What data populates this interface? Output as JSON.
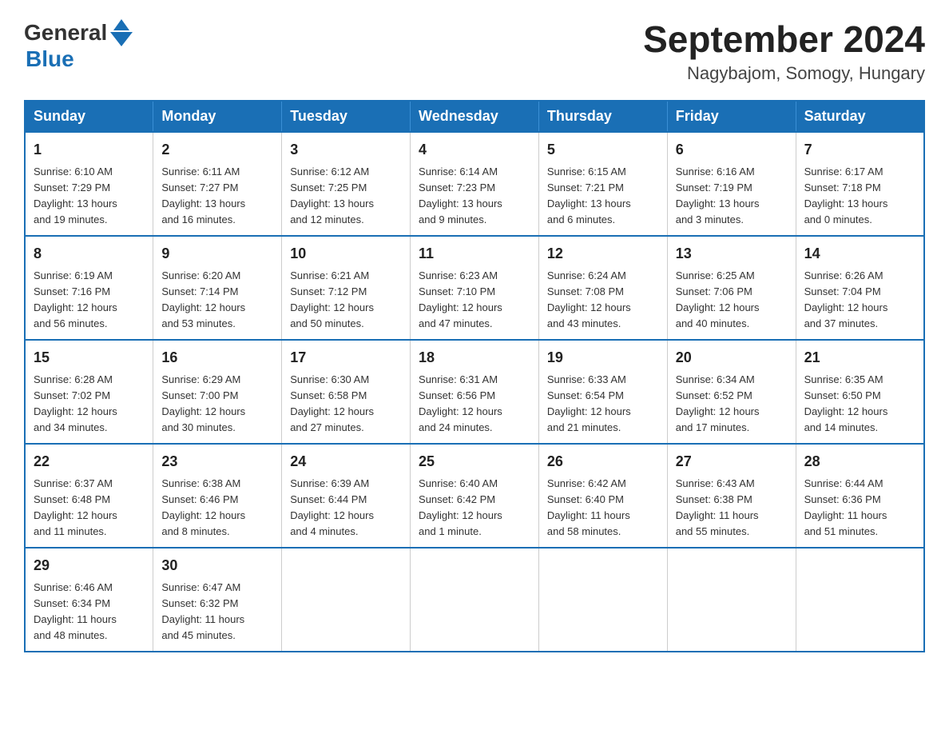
{
  "header": {
    "logo_general": "General",
    "logo_blue": "Blue",
    "title": "September 2024",
    "subtitle": "Nagybajom, Somogy, Hungary"
  },
  "days_of_week": [
    "Sunday",
    "Monday",
    "Tuesday",
    "Wednesday",
    "Thursday",
    "Friday",
    "Saturday"
  ],
  "weeks": [
    [
      {
        "day": "1",
        "sunrise": "6:10 AM",
        "sunset": "7:29 PM",
        "daylight": "13 hours and 19 minutes."
      },
      {
        "day": "2",
        "sunrise": "6:11 AM",
        "sunset": "7:27 PM",
        "daylight": "13 hours and 16 minutes."
      },
      {
        "day": "3",
        "sunrise": "6:12 AM",
        "sunset": "7:25 PM",
        "daylight": "13 hours and 12 minutes."
      },
      {
        "day": "4",
        "sunrise": "6:14 AM",
        "sunset": "7:23 PM",
        "daylight": "13 hours and 9 minutes."
      },
      {
        "day": "5",
        "sunrise": "6:15 AM",
        "sunset": "7:21 PM",
        "daylight": "13 hours and 6 minutes."
      },
      {
        "day": "6",
        "sunrise": "6:16 AM",
        "sunset": "7:19 PM",
        "daylight": "13 hours and 3 minutes."
      },
      {
        "day": "7",
        "sunrise": "6:17 AM",
        "sunset": "7:18 PM",
        "daylight": "13 hours and 0 minutes."
      }
    ],
    [
      {
        "day": "8",
        "sunrise": "6:19 AM",
        "sunset": "7:16 PM",
        "daylight": "12 hours and 56 minutes."
      },
      {
        "day": "9",
        "sunrise": "6:20 AM",
        "sunset": "7:14 PM",
        "daylight": "12 hours and 53 minutes."
      },
      {
        "day": "10",
        "sunrise": "6:21 AM",
        "sunset": "7:12 PM",
        "daylight": "12 hours and 50 minutes."
      },
      {
        "day": "11",
        "sunrise": "6:23 AM",
        "sunset": "7:10 PM",
        "daylight": "12 hours and 47 minutes."
      },
      {
        "day": "12",
        "sunrise": "6:24 AM",
        "sunset": "7:08 PM",
        "daylight": "12 hours and 43 minutes."
      },
      {
        "day": "13",
        "sunrise": "6:25 AM",
        "sunset": "7:06 PM",
        "daylight": "12 hours and 40 minutes."
      },
      {
        "day": "14",
        "sunrise": "6:26 AM",
        "sunset": "7:04 PM",
        "daylight": "12 hours and 37 minutes."
      }
    ],
    [
      {
        "day": "15",
        "sunrise": "6:28 AM",
        "sunset": "7:02 PM",
        "daylight": "12 hours and 34 minutes."
      },
      {
        "day": "16",
        "sunrise": "6:29 AM",
        "sunset": "7:00 PM",
        "daylight": "12 hours and 30 minutes."
      },
      {
        "day": "17",
        "sunrise": "6:30 AM",
        "sunset": "6:58 PM",
        "daylight": "12 hours and 27 minutes."
      },
      {
        "day": "18",
        "sunrise": "6:31 AM",
        "sunset": "6:56 PM",
        "daylight": "12 hours and 24 minutes."
      },
      {
        "day": "19",
        "sunrise": "6:33 AM",
        "sunset": "6:54 PM",
        "daylight": "12 hours and 21 minutes."
      },
      {
        "day": "20",
        "sunrise": "6:34 AM",
        "sunset": "6:52 PM",
        "daylight": "12 hours and 17 minutes."
      },
      {
        "day": "21",
        "sunrise": "6:35 AM",
        "sunset": "6:50 PM",
        "daylight": "12 hours and 14 minutes."
      }
    ],
    [
      {
        "day": "22",
        "sunrise": "6:37 AM",
        "sunset": "6:48 PM",
        "daylight": "12 hours and 11 minutes."
      },
      {
        "day": "23",
        "sunrise": "6:38 AM",
        "sunset": "6:46 PM",
        "daylight": "12 hours and 8 minutes."
      },
      {
        "day": "24",
        "sunrise": "6:39 AM",
        "sunset": "6:44 PM",
        "daylight": "12 hours and 4 minutes."
      },
      {
        "day": "25",
        "sunrise": "6:40 AM",
        "sunset": "6:42 PM",
        "daylight": "12 hours and 1 minute."
      },
      {
        "day": "26",
        "sunrise": "6:42 AM",
        "sunset": "6:40 PM",
        "daylight": "11 hours and 58 minutes."
      },
      {
        "day": "27",
        "sunrise": "6:43 AM",
        "sunset": "6:38 PM",
        "daylight": "11 hours and 55 minutes."
      },
      {
        "day": "28",
        "sunrise": "6:44 AM",
        "sunset": "6:36 PM",
        "daylight": "11 hours and 51 minutes."
      }
    ],
    [
      {
        "day": "29",
        "sunrise": "6:46 AM",
        "sunset": "6:34 PM",
        "daylight": "11 hours and 48 minutes."
      },
      {
        "day": "30",
        "sunrise": "6:47 AM",
        "sunset": "6:32 PM",
        "daylight": "11 hours and 45 minutes."
      },
      null,
      null,
      null,
      null,
      null
    ]
  ],
  "labels": {
    "sunrise": "Sunrise:",
    "sunset": "Sunset:",
    "daylight": "Daylight:"
  }
}
